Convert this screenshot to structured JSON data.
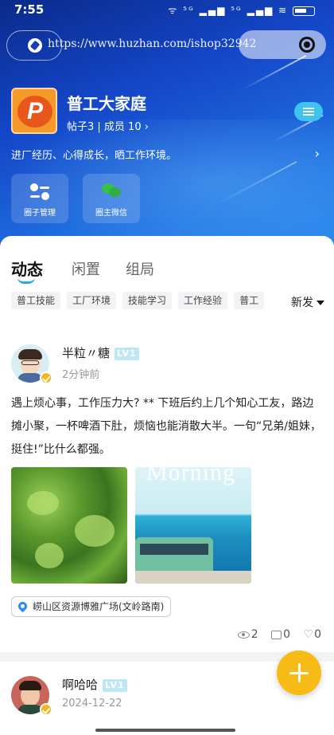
{
  "status_bar": {
    "time": "7:55",
    "signal": "ᯤ ⁵ᴳ ▂▄▆ ⁵ᴳ ▂▄▆ ≋"
  },
  "browser": {
    "url": "https://www.huzhan.com/ishop32942"
  },
  "group": {
    "name": "普工大家庭",
    "meta": "帖子3 | 成员 10 ›",
    "description": "进厂经历、心得成长，晒工作环境。",
    "tools": [
      {
        "label": "圈子管理",
        "icon": "sliders-icon"
      },
      {
        "label": "圈主微信",
        "icon": "wechat-icon"
      }
    ]
  },
  "tabs": [
    {
      "label": "动态",
      "active": true
    },
    {
      "label": "闲置",
      "active": false
    },
    {
      "label": "组局",
      "active": false
    }
  ],
  "chips": [
    "普工技能",
    "工厂环境",
    "技能学习",
    "工作经验",
    "普工"
  ],
  "sort_label": "新发",
  "posts": [
    {
      "user": "半粒〃糖",
      "level": "LV1",
      "time": "2分钟前",
      "text": "遇上烦心事，工作压力大? ** 下班后约上几个知心工友，路边摊小聚，一杯啤酒下肚，烦恼也能消散大半。一句“兄弟/姐妹，挺住!”比什么都强。",
      "image_2_caption": "Morning",
      "location": "崂山区资源博雅广场(文岭路南)",
      "views": "2",
      "comments": "0",
      "likes": "0"
    },
    {
      "user": "啊哈哈",
      "level": "LV1",
      "time": "2024-12-22"
    }
  ],
  "colors": {
    "accent": "#2aa5f5",
    "fab": "#f7bb16",
    "hero_top": "#0a2a8a",
    "hero_bottom": "#2b8ef0"
  }
}
